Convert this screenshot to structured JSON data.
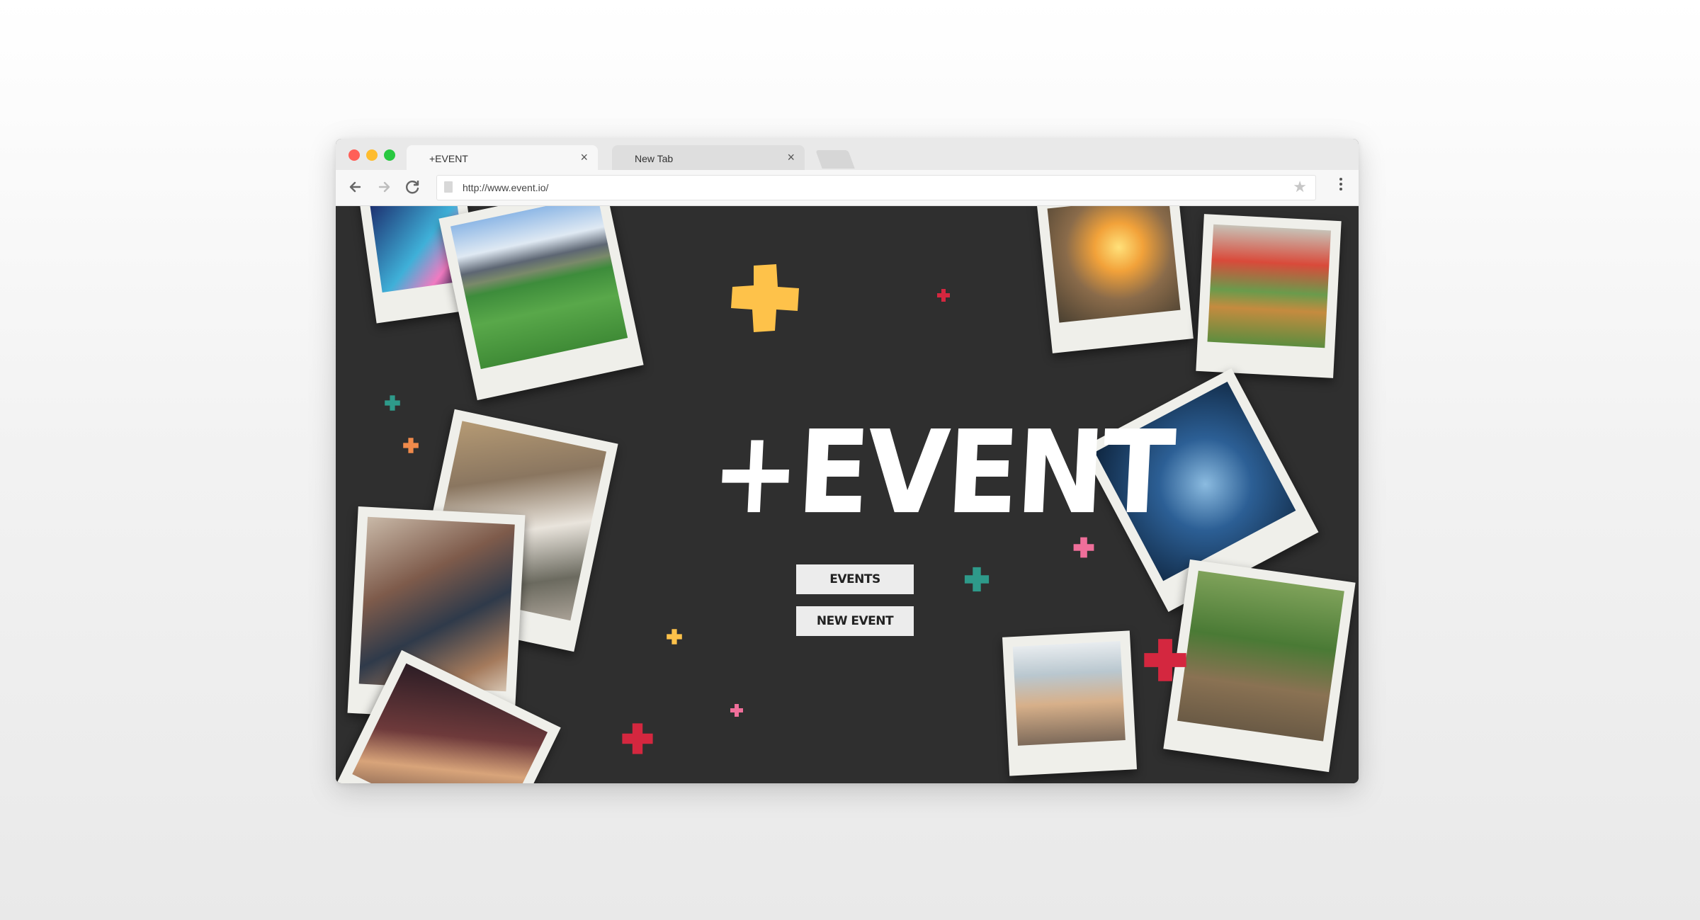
{
  "browser": {
    "tabs": [
      {
        "label": "+EVENT",
        "active": true
      },
      {
        "label": "New Tab",
        "active": false
      }
    ],
    "address": "http://www.event.io/",
    "icons": [
      "back-arrow-icon",
      "forward-arrow-icon",
      "reload-icon",
      "page-icon",
      "star-icon",
      "menu-dots-icon",
      "close-icon"
    ]
  },
  "page": {
    "logo": "+EVENT",
    "buttons": {
      "events": "EVENTS",
      "new_event": "NEW EVENT"
    },
    "colors": {
      "background": "#2f2f2f",
      "yellow": "#fec24a",
      "teal": "#2e9a8a",
      "orange": "#f08a4b",
      "pink": "#ef6f9a",
      "red": "#d4273f",
      "button_bg": "#ececec"
    },
    "photos": [
      "carnival-night",
      "baseball-stadium",
      "wedding-hall",
      "friends-dinner",
      "concert-crowd",
      "jumping-festival",
      "golden-retriever",
      "guitarist-on-stage",
      "motocross-rider",
      "festival-crowd"
    ]
  }
}
